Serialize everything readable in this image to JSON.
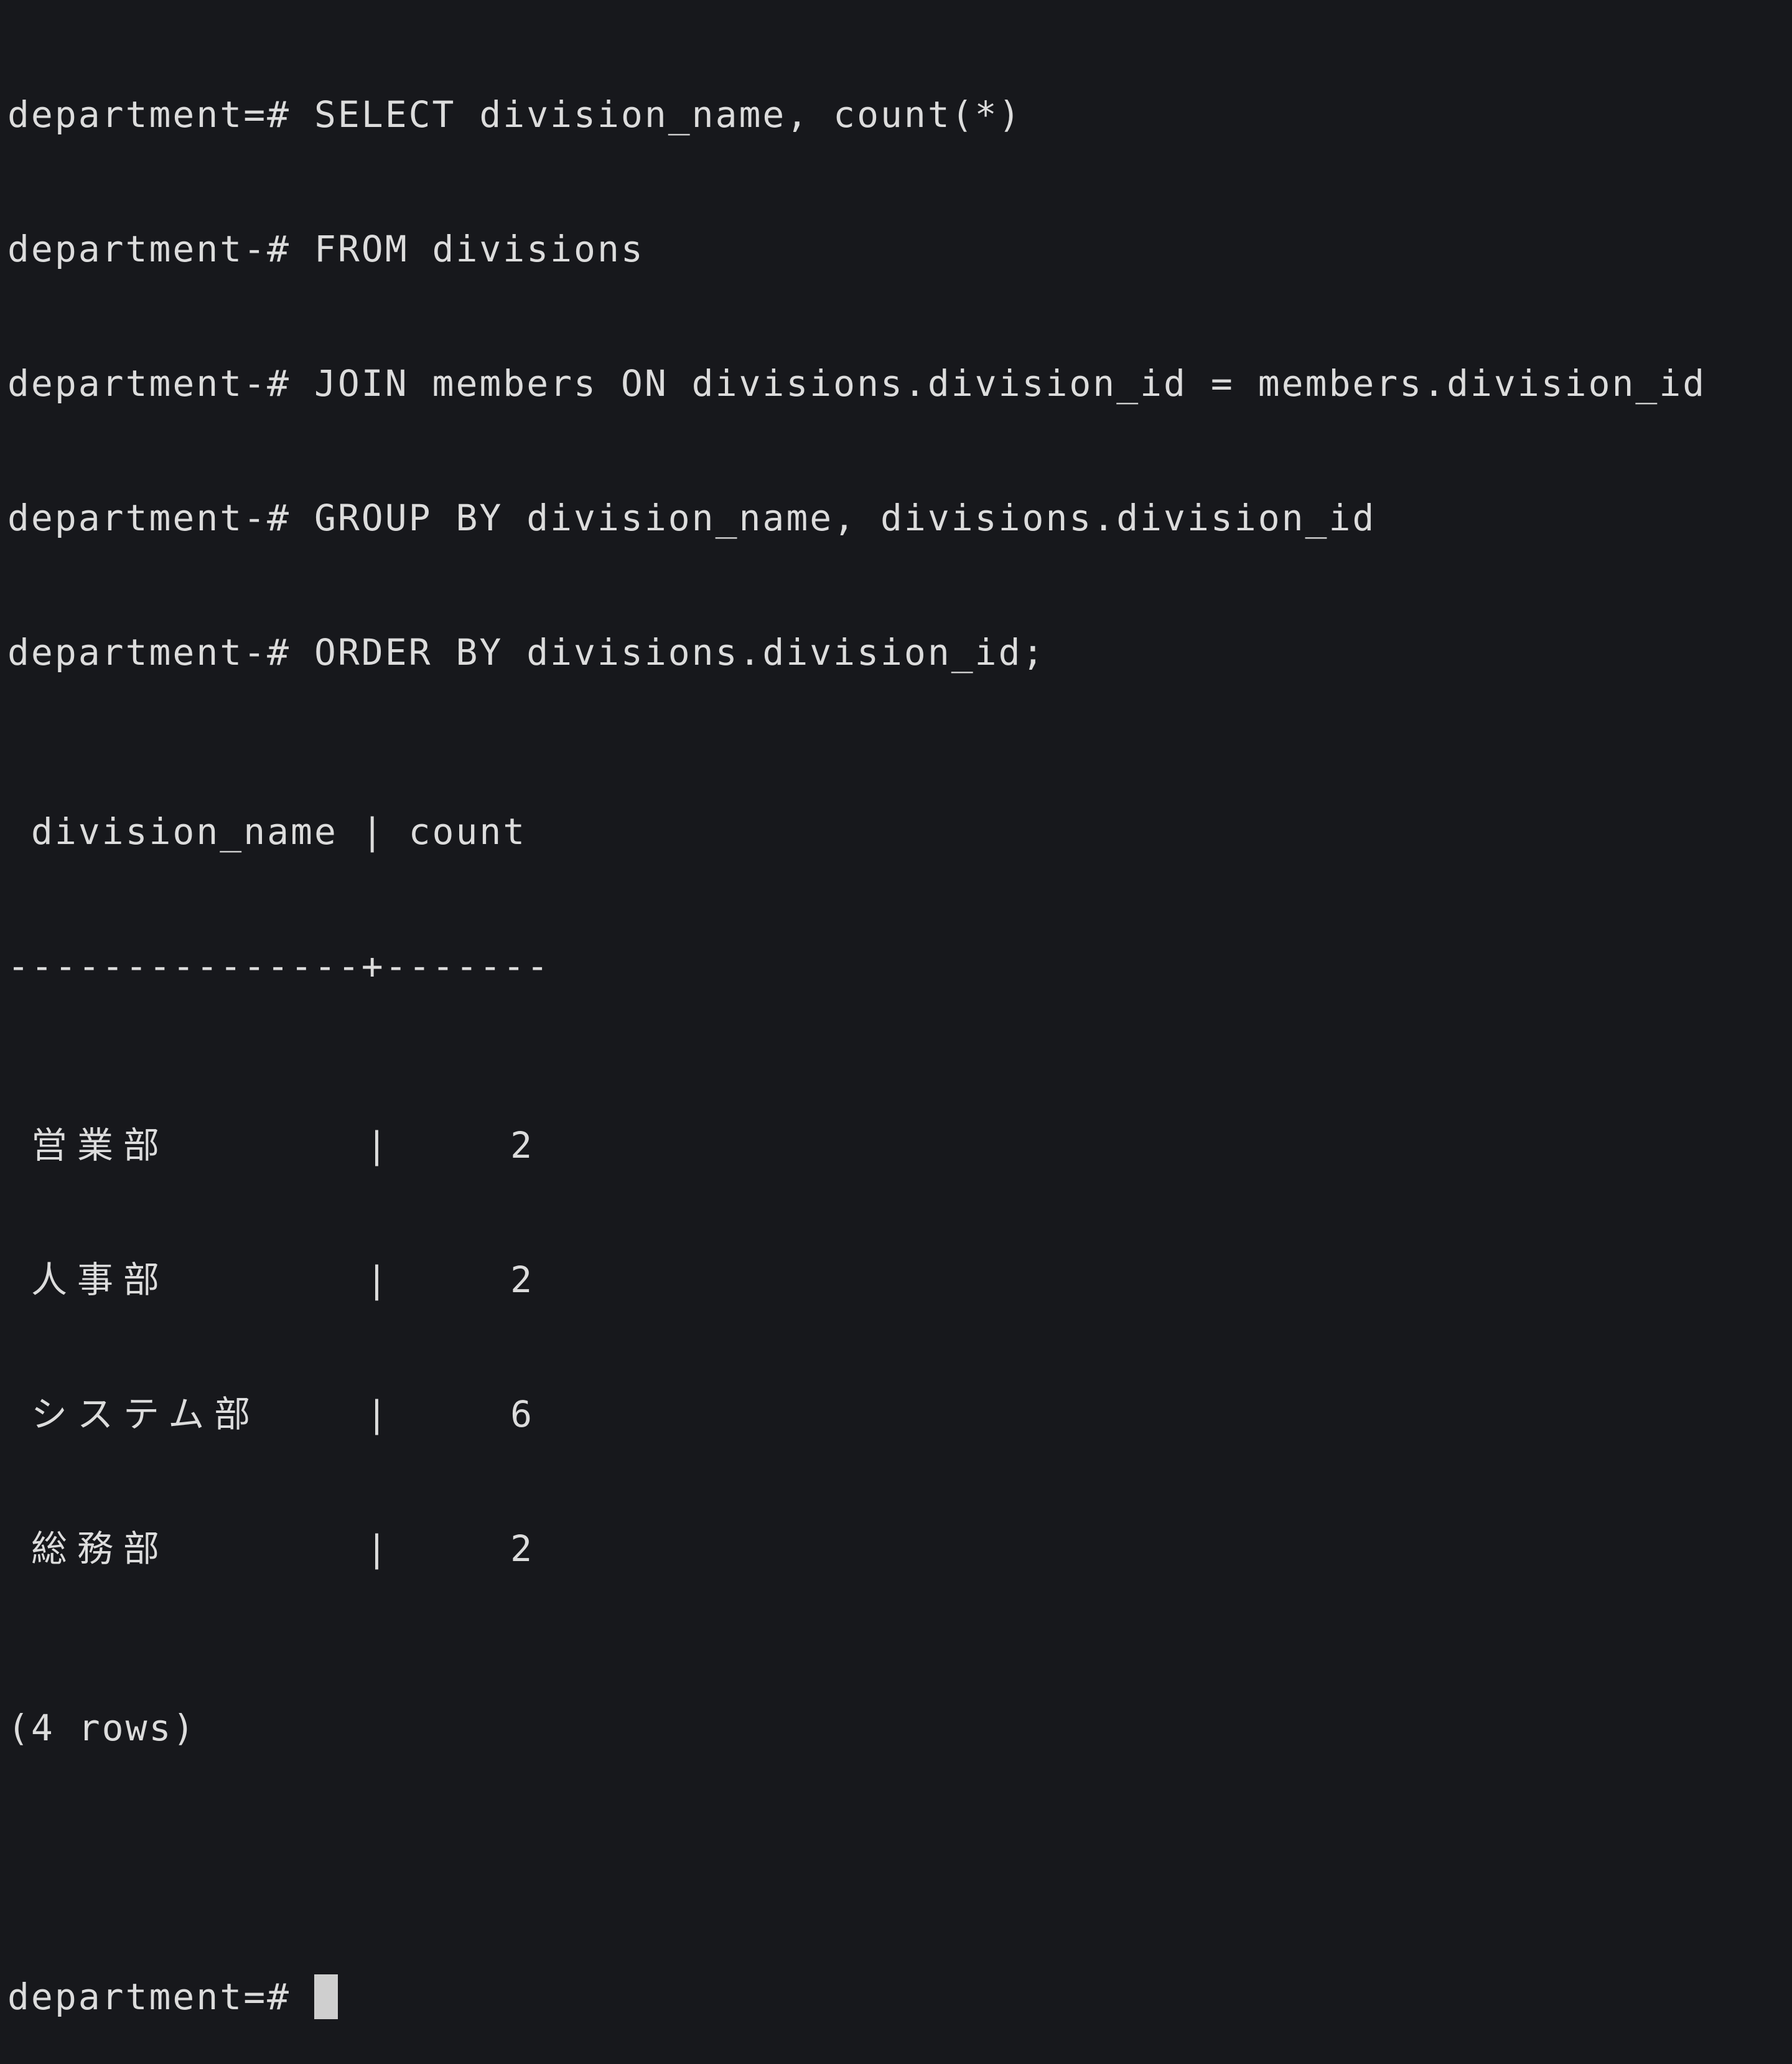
{
  "terminal": {
    "query_lines": [
      {
        "prompt": "department=#",
        "text": "SELECT division_name, count(*)"
      },
      {
        "prompt": "department-#",
        "text": "FROM divisions"
      },
      {
        "prompt": "department-#",
        "text": "JOIN members ON divisions.division_id = members.division_id"
      },
      {
        "prompt": "department-#",
        "text": "GROUP BY division_name, divisions.division_id"
      },
      {
        "prompt": "department-#",
        "text": "ORDER BY divisions.division_id;"
      }
    ],
    "result": {
      "header": " division_name | count",
      "separator": "---------------+-------",
      "rows": [
        {
          "division_name": "営業部",
          "count": "2"
        },
        {
          "division_name": "人事部",
          "count": "2"
        },
        {
          "division_name": "システム部",
          "count": "6"
        },
        {
          "division_name": "総務部",
          "count": "2"
        }
      ],
      "footer": "(4 rows)"
    },
    "final_prompt": "department=#",
    "colors": {
      "background": "#17181c",
      "text": "#dcdcdc",
      "cursor": "#cfcfcf"
    }
  }
}
